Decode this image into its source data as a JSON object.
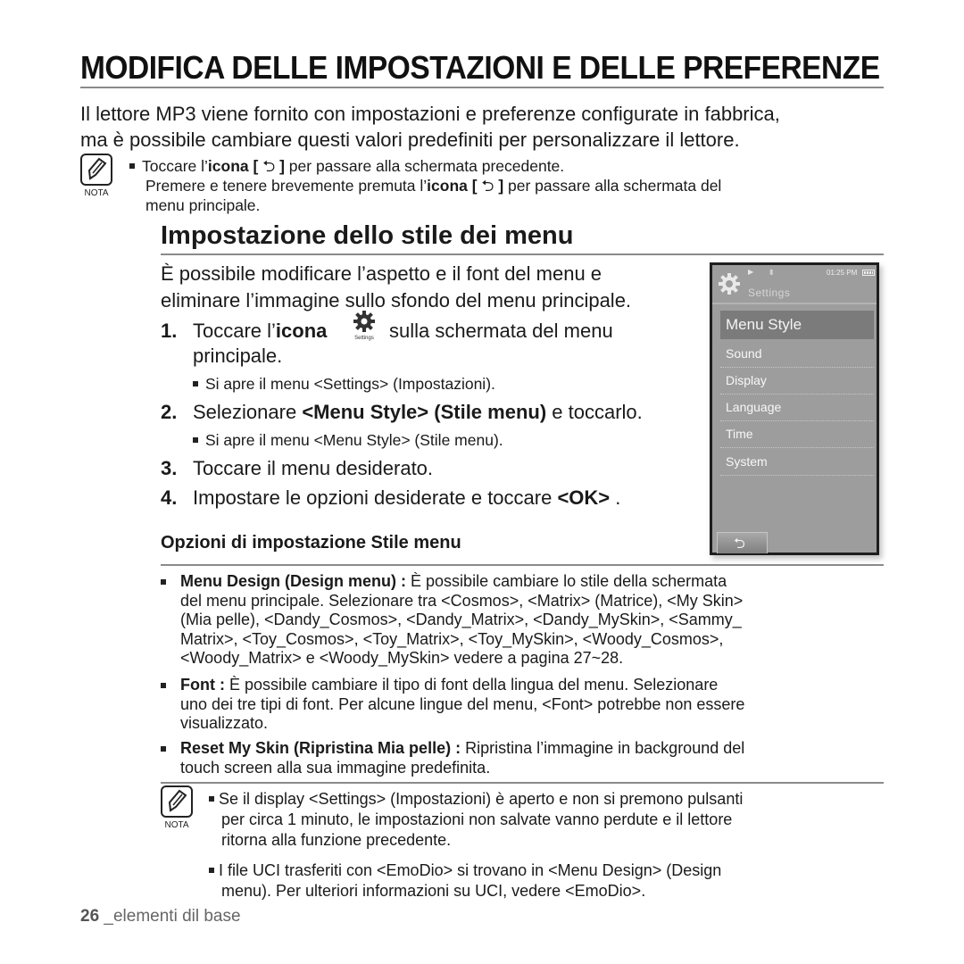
{
  "header": {
    "title": "MODIFICA DELLE IMPOSTAZIONI E DELLE PREFERENZE"
  },
  "intro": {
    "line1": "Il lettore MP3 viene fornito con impostazioni e preferenze configurate in fabbrica,",
    "line2": "ma è possibile cambiare questi valori predefiniti per personalizzare il lettore."
  },
  "note_top": {
    "icon_label": "NOTA",
    "line1_pre": "Toccare l’",
    "line1_bold": "icona [ ",
    "line1_icon": "⮌",
    "line1_bold_end": " ]",
    "line1_post": " per passare alla schermata precedente.",
    "line2_pre": "Premere e tenere brevemente premuta l’",
    "line2_bold": "icona [ ",
    "line2_icon": "⮌",
    "line2_bold_end": " ]",
    "line2_post": " per passare alla schermata del",
    "line3": "menu principale."
  },
  "section": {
    "title": "Impostazione dello stile dei menu",
    "para_line1": "È possibile modificare l’aspetto e il font del menu e",
    "para_line2": "eliminare l’immagine sullo sfondo del menu principale.",
    "steps": [
      {
        "num": "1.",
        "pre": "Toccare l’",
        "bold": "icona",
        "post": "sulla schermata del menu",
        "line2": "principale.",
        "icon_caption": "Settings",
        "sub": "Si apre il menu <Settings> (Impostazioni)."
      },
      {
        "num": "2.",
        "pre": "Selezionare ",
        "bold": "<Menu Style> (Stile menu)",
        "post": " e toccarlo.",
        "sub": "Si apre il menu  <Menu Style> (Stile menu)."
      },
      {
        "num": "3.",
        "text": "Toccare il menu desiderato."
      },
      {
        "num": "4.",
        "pre": "Impostare le opzioni desiderate e toccare ",
        "bold": "<OK>",
        "post": " ."
      }
    ],
    "options_title": "Opzioni di impostazione Stile menu",
    "options": [
      {
        "term": "Menu Design (Design menu) :",
        "lines": [
          "È possibile cambiare lo stile della schermata",
          "del menu principale. Selezionare tra <Cosmos>, <Matrix> (Matrice), <My Skin>",
          "(Mia pelle), <Dandy_Cosmos>, <Dandy_Matrix>, <Dandy_MySkin>, <Sammy_",
          "Matrix>, <Toy_Cosmos>, <Toy_Matrix>, <Toy_MySkin>, <Woody_Cosmos>,",
          "<Woody_Matrix> e <Woody_MySkin> vedere a pagina 27~28."
        ]
      },
      {
        "term": "Font :",
        "lines": [
          "È possibile cambiare il tipo di font della lingua del menu. Selezionare",
          "uno dei tre tipi di font. Per alcune lingue del menu, <Font> potrebbe non essere",
          "visualizzato."
        ]
      },
      {
        "term": "Reset My Skin (Ripristina Mia pelle) :",
        "lines": [
          "Ripristina l’immagine in background del",
          "touch screen alla sua immagine predefinita."
        ]
      }
    ]
  },
  "device": {
    "status_time": "01:25 PM",
    "screen_title": "Settings",
    "selected_item": "Menu Style",
    "items": [
      "Sound",
      "Display",
      "Language",
      "Time",
      "System"
    ],
    "back_icon": "⮌"
  },
  "note_bottom": {
    "icon_label": "NOTA",
    "item1": [
      "Se il display <Settings> (Impostazioni) è aperto e non si premono pulsanti",
      "per circa 1 minuto, le impostazioni non salvate vanno perdute e il lettore",
      "ritorna alla funzione precedente."
    ],
    "item2": [
      "I file UCI trasferiti con <EmoDio> si trovano in <Menu Design> (Design",
      "menu). Per ulteriori informazioni su UCI, vedere <EmoDio>."
    ]
  },
  "footer": {
    "page_number": "26",
    "section_label": " _elementi dil base"
  }
}
